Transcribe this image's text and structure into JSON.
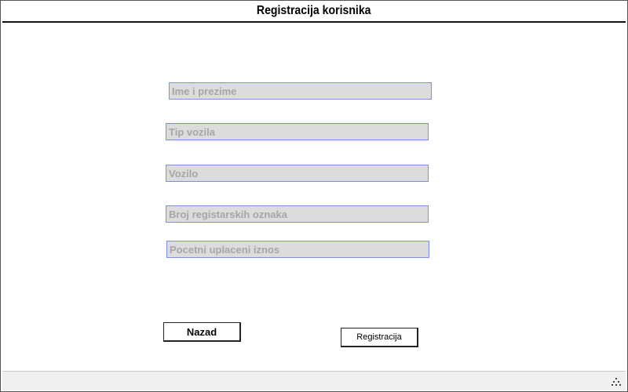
{
  "window": {
    "title": "Registracija korisnika"
  },
  "form": {
    "full_name": {
      "value": "",
      "placeholder": "Ime i prezime"
    },
    "vehicle_type": {
      "value": "",
      "placeholder": "Tip vozila"
    },
    "vehicle": {
      "value": "",
      "placeholder": "Vozilo"
    },
    "plate_number": {
      "value": "",
      "placeholder": "Broj registarskih oznaka"
    },
    "initial_payment": {
      "value": "",
      "placeholder": "Pocetni uplaceni iznos"
    }
  },
  "buttons": {
    "back_label": "Nazad",
    "register_label": "Registracija"
  },
  "icons": {
    "resize_grip": "resize-grip-icon"
  },
  "colors": {
    "field_background": "#dcdcdc",
    "field_border": "#7a8fe0",
    "placeholder_text": "#a6a6a6"
  }
}
